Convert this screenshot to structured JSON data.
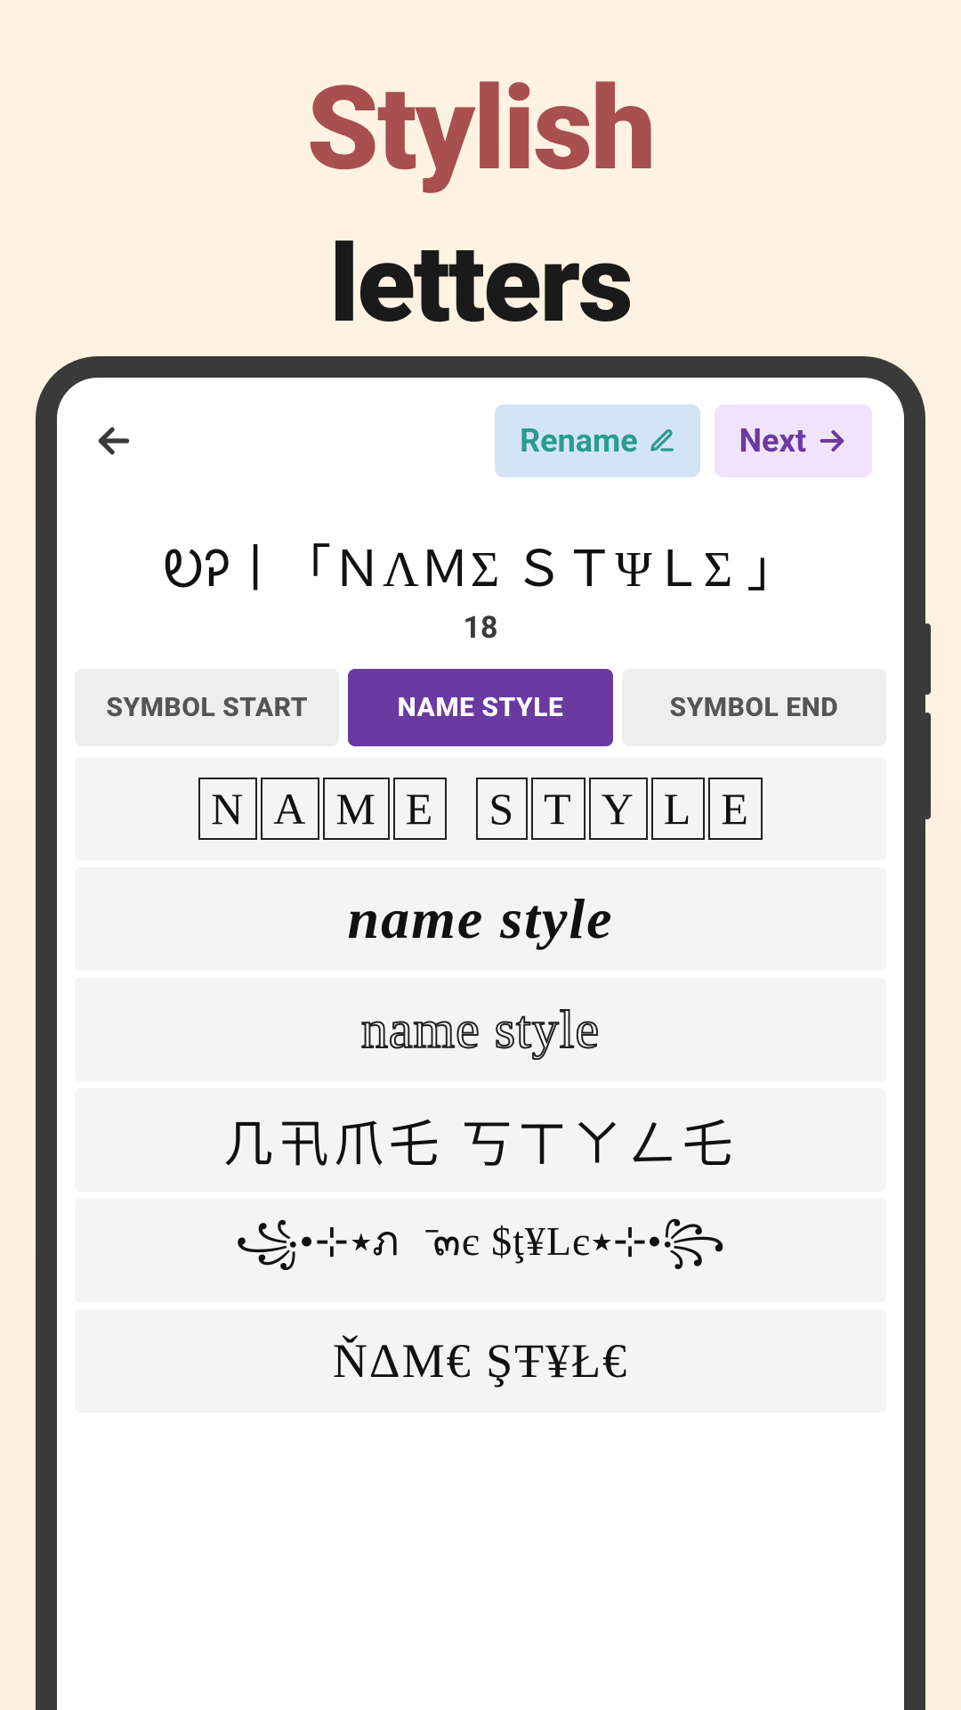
{
  "promo": {
    "word1": "Stylish",
    "word2": "letters"
  },
  "toolbar": {
    "rename_label": "Rename",
    "next_label": "Next"
  },
  "preview": {
    "name": "ᎧᎮ丨「ＮΛＭΣ ＳＴΨＬΣ 」",
    "counter": "18"
  },
  "tabs": {
    "symbol_start": "SYMBOL START",
    "name_style": "NAME STYLE",
    "symbol_end": "SYMBOL END"
  },
  "styles": {
    "item2": "name style",
    "item3": "name style",
    "item4": "几卂爪乇 丂ㄒㄚㄥ乇",
    "item5": "꧁•⊹٭ภค̄๓є $ţ¥Lє٭⊹•꧂",
    "item6": "ŇΔM€ ŞŦ¥Ł€"
  }
}
